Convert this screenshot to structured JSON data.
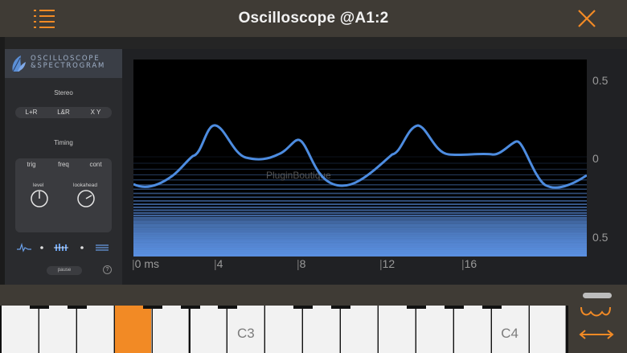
{
  "titlebar": {
    "title": "Oscilloscope @A1:2",
    "accent": "#f28a25"
  },
  "logo": {
    "line1": "OSCILLOSCOPE",
    "line2": "&SPECTROGRAM"
  },
  "stereo": {
    "label": "Stereo",
    "options": [
      "L+R",
      "L&R",
      "X Y"
    ]
  },
  "timing": {
    "label": "Timing",
    "tabs": [
      "trig",
      "freq",
      "cont"
    ],
    "knobs": [
      {
        "label": "level"
      },
      {
        "label": "lookahead"
      }
    ]
  },
  "controls": {
    "pause_label": "pause",
    "help_label": "?"
  },
  "scope": {
    "y_labels": [
      "0.5",
      "0",
      "0.5"
    ],
    "x_labels": [
      "0 ms",
      "4",
      "8",
      "12",
      "16"
    ],
    "watermark": "PluginBoutique"
  },
  "keyboard": {
    "labels": {
      "c3": "C3",
      "c4": "C4"
    },
    "active_key_index": 3
  },
  "colors": {
    "wave": "#4d8ce0",
    "bars": "#5a8fe0",
    "panel": "#2a2b2e",
    "bar_bg": "#3f3b35"
  }
}
